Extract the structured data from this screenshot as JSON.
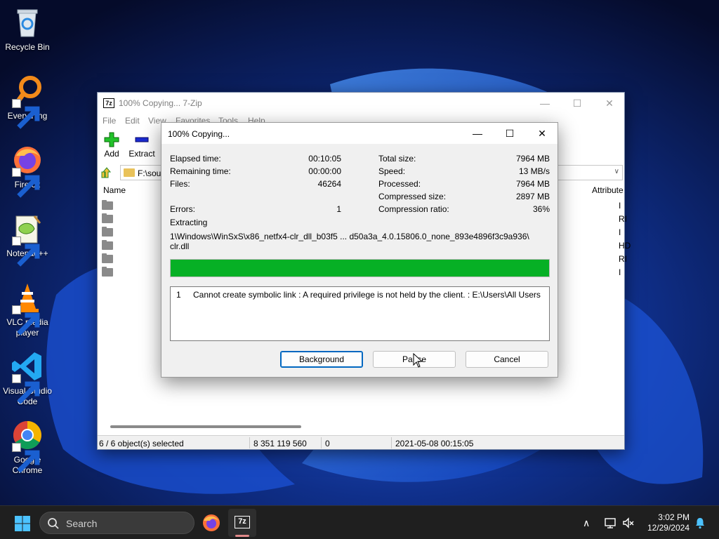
{
  "desktop": {
    "icons": [
      {
        "label": "Recycle Bin",
        "icon": "recycle-bin-icon"
      },
      {
        "label": "Everything",
        "icon": "everything-search-icon"
      },
      {
        "label": "Firefox",
        "icon": "firefox-icon"
      },
      {
        "label": "Notepad++",
        "icon": "notepad-plus-plus-icon"
      },
      {
        "label": "VLC media player",
        "icon": "vlc-cone-icon"
      },
      {
        "label": "Visual Studio Code",
        "icon": "vscode-icon"
      },
      {
        "label": "Google Chrome",
        "icon": "chrome-icon"
      }
    ]
  },
  "main_window": {
    "title": "100% Copying... 7-Zip",
    "app_icon_text": "7z",
    "menu": [
      "File",
      "Edit",
      "View",
      "Favorites",
      "Tools",
      "Help"
    ],
    "toolbar": {
      "add_label": "Add",
      "extract_label": "Extract"
    },
    "address": {
      "path": "F:\\sour"
    },
    "columns": {
      "name": "Name",
      "attributes": "Attribute"
    },
    "rows": [
      {
        "attr": "I"
      },
      {
        "attr": "RI"
      },
      {
        "attr": "I"
      },
      {
        "attr": "HD"
      },
      {
        "attr": "RI"
      },
      {
        "attr": "I"
      }
    ],
    "status": {
      "selected": "6 / 6 object(s) selected",
      "size": "8 351 119 560",
      "packed": "0",
      "modified": "2021-05-08 00:15:05"
    }
  },
  "dialog": {
    "title": "100% Copying...",
    "stats_left": [
      {
        "label": "Elapsed time:",
        "value": "00:10:05"
      },
      {
        "label": "Remaining time:",
        "value": "00:00:00"
      },
      {
        "label": "Files:",
        "value": "46264"
      },
      {
        "label": "Errors:",
        "value": "1"
      }
    ],
    "stats_right": [
      {
        "label": "Total size:",
        "value": "7964 MB"
      },
      {
        "label": "Speed:",
        "value": "13 MB/s"
      },
      {
        "label": "Processed:",
        "value": "7964 MB"
      },
      {
        "label": "Compressed size:",
        "value": "2897 MB"
      },
      {
        "label": "Compression ratio:",
        "value": "36%"
      }
    ],
    "operation": "Extracting",
    "current_file_line1": "1\\Windows\\WinSxS\\x86_netfx4-clr_dll_b03f5 ... d50a3a_4.0.15806.0_none_893e4896f3c9a936\\",
    "current_file_line2": "clr.dll",
    "progress_percent": 100,
    "progress_color": "#06b025",
    "errors": [
      {
        "num": "1",
        "message": "Cannot create symbolic link : A required privilege is not held by the client. : E:\\Users\\All Users"
      }
    ],
    "buttons": {
      "background": "Background",
      "pause": "Pause",
      "cancel": "Cancel"
    }
  },
  "taskbar": {
    "search_placeholder": "Search",
    "time": "3:02 PM",
    "date": "12/29/2024"
  }
}
